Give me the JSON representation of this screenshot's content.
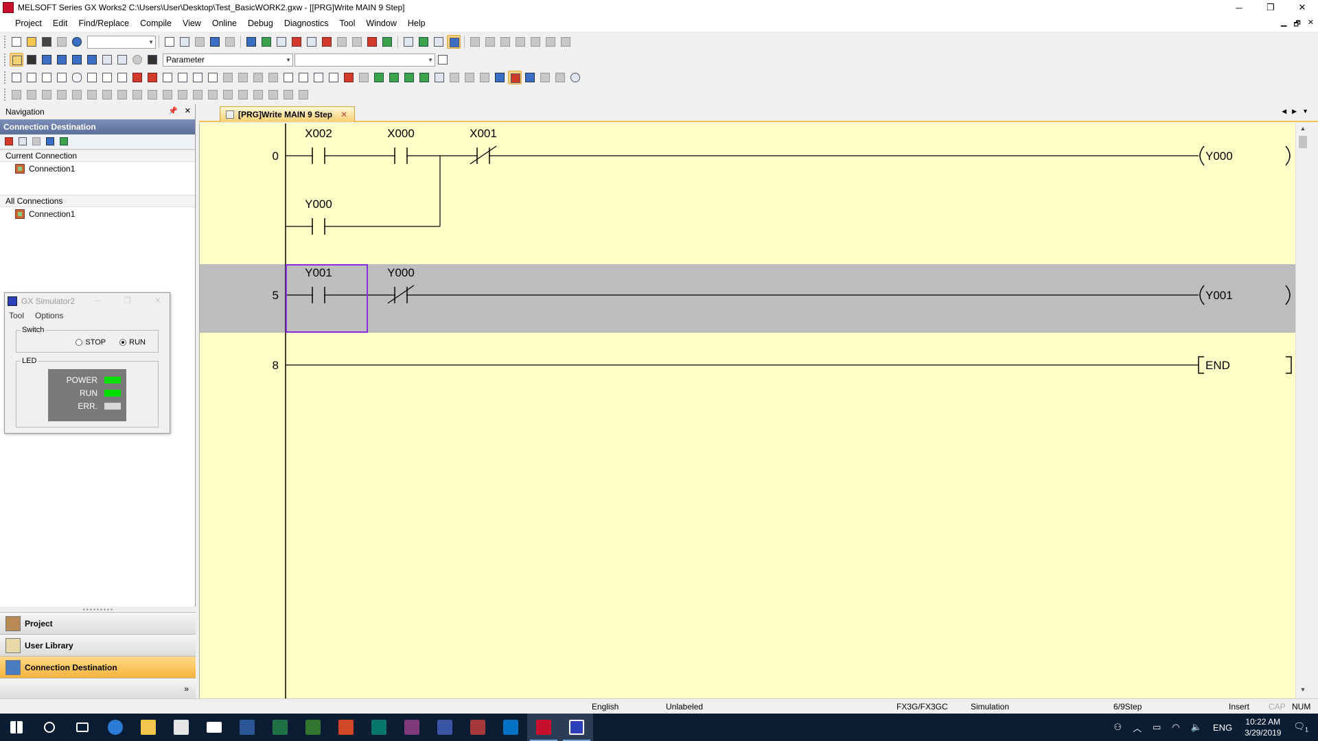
{
  "window": {
    "title": "MELSOFT Series GX Works2 C:\\Users\\User\\Desktop\\Test_BasicWORK2.gxw - [[PRG]Write MAIN 9 Step]",
    "minimize": "─",
    "restore": "❐",
    "close": "✕"
  },
  "menu": {
    "items": [
      "Project",
      "Edit",
      "Find/Replace",
      "Compile",
      "View",
      "Online",
      "Debug",
      "Diagnostics",
      "Tool",
      "Window",
      "Help"
    ],
    "mdi_minimize": "▁",
    "mdi_restore": "🗗",
    "mdi_close": "✕"
  },
  "toolbar": {
    "parameter_combo": "Parameter"
  },
  "navigation": {
    "title": "Navigation",
    "pin": "📌",
    "close": "✕",
    "panel_title": "Connection Destination",
    "current_connection_label": "Current Connection",
    "current_connection": "Connection1",
    "all_connections_label": "All Connections",
    "all_connections": "Connection1",
    "bottom": {
      "project": "Project",
      "user_library": "User Library",
      "connection_destination": "Connection Destination",
      "more": "»"
    }
  },
  "simulator": {
    "title": "GX Simulator2",
    "menu": [
      "Tool",
      "Options"
    ],
    "switch_label": "Switch",
    "stop_label": "STOP",
    "run_label": "RUN",
    "selected": "RUN",
    "led_label": "LED",
    "leds": [
      {
        "name": "POWER",
        "color": "#00e000"
      },
      {
        "name": "RUN",
        "color": "#00e000"
      },
      {
        "name": "ERR.",
        "color": "#d8d8d8"
      }
    ]
  },
  "tab": {
    "label": "[PRG]Write MAIN 9 Step",
    "close": "✕"
  },
  "ladder": {
    "rungs": [
      {
        "step": "0",
        "contacts": [
          {
            "device": "X002",
            "type": "NO"
          },
          {
            "device": "X000",
            "type": "NO"
          },
          {
            "device": "X001",
            "type": "NC"
          }
        ],
        "branch": {
          "device": "Y000",
          "type": "NO"
        },
        "coil": "Y000"
      },
      {
        "step": "5",
        "contacts": [
          {
            "device": "Y001",
            "type": "NO"
          },
          {
            "device": "Y000",
            "type": "NC"
          }
        ],
        "coil": "Y001",
        "selected": true
      },
      {
        "step": "8",
        "end": "END"
      }
    ],
    "colors": {
      "background": "#ffffc8",
      "selected_row": "#bdbdbd",
      "line": "#000000",
      "cursor": "#8a2be2"
    }
  },
  "status": {
    "language": "English",
    "label": "Unlabeled",
    "plc": "FX3G/FX3GC",
    "mode": "Simulation",
    "steps": "6/9Step",
    "insert": "Insert",
    "cap": "CAP",
    "num": "NUM"
  },
  "taskbar": {
    "language": "ENG",
    "time": "10:22 AM",
    "date": "3/29/2019",
    "notifications": "1"
  }
}
